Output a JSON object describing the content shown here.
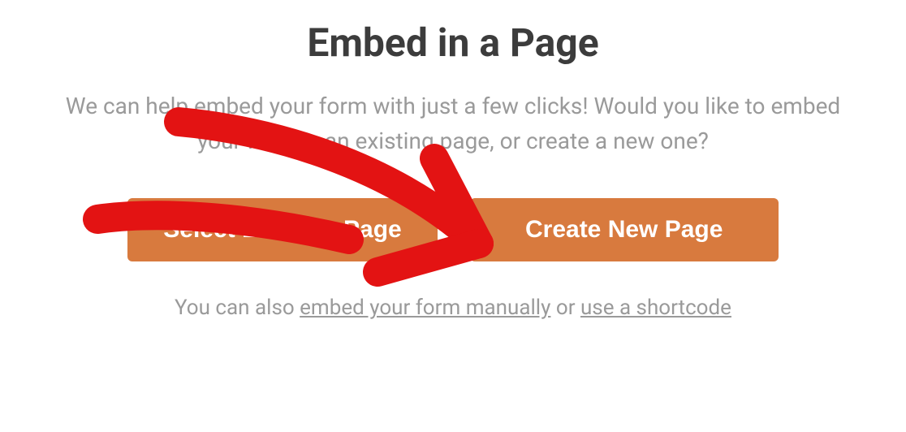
{
  "dialog": {
    "title": "Embed in a Page",
    "description": "We can help embed your form with just a few clicks! Would you like to embed your form in an existing page, or create a new one?",
    "buttons": {
      "select_existing": "Select Existing Page",
      "create_new": "Create New Page"
    },
    "footer": {
      "prefix": "You can also ",
      "link_manual": "embed your form manually",
      "mid": " or ",
      "link_shortcode": "use a shortcode"
    }
  },
  "annotation": {
    "color": "#e31313"
  }
}
